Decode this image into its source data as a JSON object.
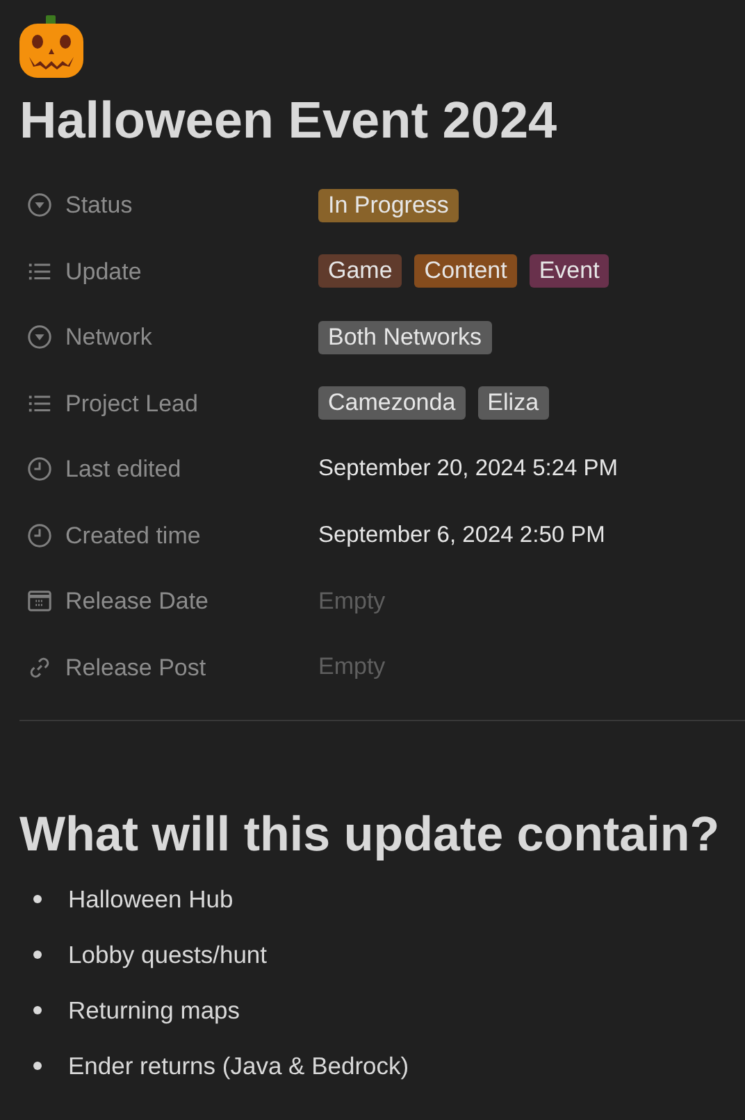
{
  "title": "Halloween Event 2024",
  "properties": [
    {
      "name": "Status",
      "kind": "select",
      "tags": [
        {
          "label": "In Progress",
          "color": "#89632a"
        }
      ]
    },
    {
      "name": "Update",
      "kind": "multi_select",
      "tags": [
        {
          "label": "Game",
          "color": "#603b2c"
        },
        {
          "label": "Content",
          "color": "#854c1d"
        },
        {
          "label": "Event",
          "color": "#69314c"
        }
      ]
    },
    {
      "name": "Network",
      "kind": "select",
      "tags": [
        {
          "label": "Both Networks",
          "color": "#5a5a5a"
        }
      ]
    },
    {
      "name": "Project Lead",
      "kind": "multi_select",
      "tags": [
        {
          "label": "Camezonda",
          "color": "#5a5a5a"
        },
        {
          "label": "Eliza",
          "color": "#5a5a5a"
        }
      ]
    },
    {
      "name": "Last edited",
      "kind": "timestamp",
      "value": "September 20, 2024 5:24 PM"
    },
    {
      "name": "Created time",
      "kind": "timestamp",
      "value": "September 6, 2024 2:50 PM"
    },
    {
      "name": "Release Date",
      "kind": "date",
      "placeholder": "Empty"
    },
    {
      "name": "Release Post",
      "kind": "url",
      "placeholder": "Empty"
    }
  ],
  "heading": "What will this update contain?",
  "bullets": [
    "Halloween Hub",
    "Lobby quests/hunt",
    "Returning maps",
    "Ender returns (Java & Bedrock)"
  ]
}
